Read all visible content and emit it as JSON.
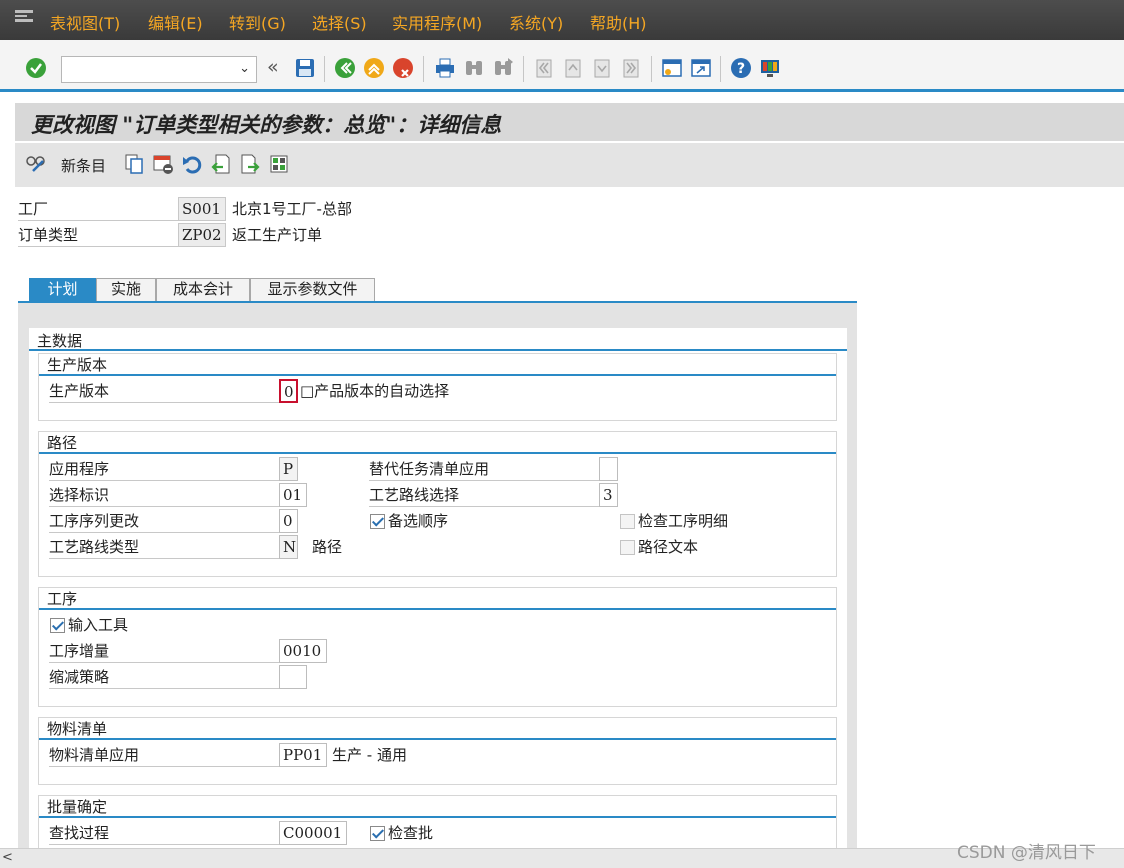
{
  "menubar": {
    "items": [
      "表视图(T)",
      "编辑(E)",
      "转到(G)",
      "选择(S)",
      "实用程序(M)",
      "系统(Y)",
      "帮助(H)"
    ]
  },
  "toolbar": {
    "command_field_value": "",
    "back_glyph": "«",
    "icons": [
      "enter-icon",
      "save-icon",
      "back-icon",
      "exit-icon",
      "cancel-icon",
      "print-icon",
      "find-icon",
      "find-next-icon",
      "first-page-icon",
      "previous-page-icon",
      "next-page-icon",
      "last-page-icon",
      "create-session-icon",
      "shortcut-icon",
      "help-icon",
      "customize-layout-icon"
    ]
  },
  "title": "更改视图 \"订单类型相关的参数：总览\"：详细信息",
  "app_toolbar": {
    "new_entries_label": "新条目",
    "icons": [
      "display-change-icon",
      "copy-icon",
      "delete-icon",
      "undo-icon",
      "previous-entry-icon",
      "next-entry-icon",
      "select-all-icon"
    ]
  },
  "header": {
    "plant_label": "工厂",
    "plant_value": "S001",
    "plant_desc": "北京1号工厂-总部",
    "order_type_label": "订单类型",
    "order_type_value": "ZP02",
    "order_type_desc": "返工生产订单"
  },
  "tabs": [
    {
      "label": "计划",
      "active": true
    },
    {
      "label": "实施",
      "active": false
    },
    {
      "label": "成本会计",
      "active": false
    },
    {
      "label": "显示参数文件",
      "active": false
    }
  ],
  "master_data": {
    "title": "主数据",
    "production_version": {
      "title": "生产版本",
      "field_label": "生产版本",
      "field_value": "0",
      "field_desc": "□产品版本的自动选择"
    },
    "routing": {
      "title": "路径",
      "application_label": "应用程序",
      "application_value": "P",
      "alt_task_list_label": "替代任务清单应用",
      "alt_task_list_value": "",
      "selection_id_label": "选择标识",
      "selection_id_value": "01",
      "routing_selection_label": "工艺路线选择",
      "routing_selection_value": "3",
      "op_seq_change_label": "工序序列更改",
      "op_seq_change_value": "0",
      "alt_sequence_label": "备选顺序",
      "alt_sequence_checked": true,
      "check_op_details_label": "检查工序明细",
      "check_op_details_checked": false,
      "routing_type_label": "工艺路线类型",
      "routing_type_value": "N",
      "routing_type_desc": "路径",
      "routing_text_label": "路径文本",
      "routing_text_checked": false
    },
    "operation": {
      "title": "工序",
      "enter_tools_label": "输入工具",
      "enter_tools_checked": true,
      "op_increment_label": "工序增量",
      "op_increment_value": "0010",
      "reduction_strategy_label": "缩减策略",
      "reduction_strategy_value": ""
    },
    "bom": {
      "title": "物料清单",
      "bom_app_label": "物料清单应用",
      "bom_app_value": "PP01",
      "bom_app_desc": "生产 - 通用"
    },
    "batch": {
      "title": "批量确定",
      "search_proc_label": "查找过程",
      "search_proc_value": "C00001",
      "check_batch_label": "检查批",
      "check_batch_checked": true
    }
  },
  "watermark": "CSDN @清风日下",
  "colors": {
    "menubar_text": "#f4a623",
    "accent_blue": "#2a8ac6",
    "enter_green": "#3aa13a",
    "exit_orange": "#f0a818",
    "cancel_red": "#d9442c"
  }
}
